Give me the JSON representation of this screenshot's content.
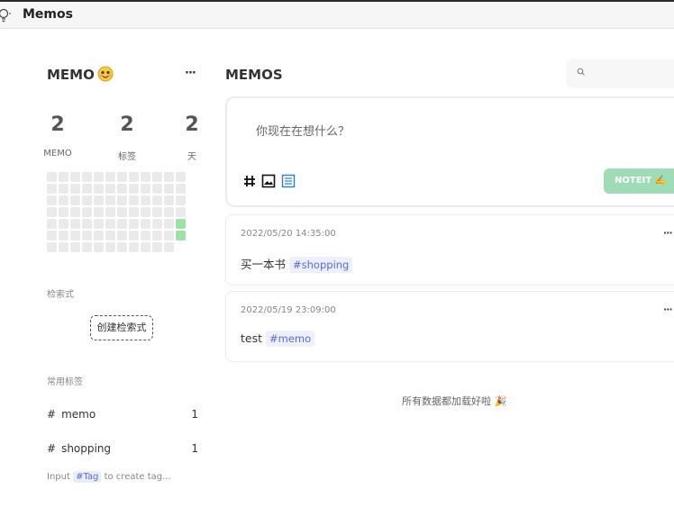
{
  "window": {
    "title": "Memos",
    "icon": "lightbulb-icon"
  },
  "sidebar": {
    "user_title": "MEMO",
    "emoji_icon": "smiling-face-icon",
    "more_label": "···",
    "stats": [
      {
        "value": "2",
        "label": "MEMO"
      },
      {
        "value": "2",
        "label": "标签"
      },
      {
        "value": "2",
        "label": "天"
      }
    ],
    "heatmap": {
      "rows": 7,
      "cols": 12,
      "active_cells": [
        [
          4,
          11
        ],
        [
          5,
          11
        ]
      ]
    },
    "query_section_label": "检索式",
    "create_query_label": "创建检索式",
    "tags_section_label": "常用标签",
    "tags": [
      {
        "hash": "#",
        "name": "memo",
        "count": "1"
      },
      {
        "hash": "#",
        "name": "shopping",
        "count": "1"
      }
    ],
    "hint": {
      "prefix": "Input",
      "chip": "#Tag",
      "suffix": "to create tag..."
    }
  },
  "main": {
    "title": "MEMOS",
    "search": {
      "icon": "search-icon",
      "placeholder": ""
    },
    "editor": {
      "placeholder": "你现在在想什么？",
      "tools": [
        "hash-icon",
        "image-icon",
        "list-icon"
      ],
      "save_label": "NOTEIT ✍️"
    },
    "memos": [
      {
        "timestamp": "2022/05/20 14:35:00",
        "text": "买一本书",
        "tag": "#shopping",
        "more": "···"
      },
      {
        "timestamp": "2022/05/19 23:09:00",
        "text": "test",
        "tag": "#memo",
        "more": "···"
      }
    ],
    "footer": "所有数据都加载好啦 🎉"
  },
  "colors": {
    "accent_green": "#9fdcb5",
    "heatmap_active": "#9be3a5",
    "tag_text": "#5b6bd8"
  }
}
